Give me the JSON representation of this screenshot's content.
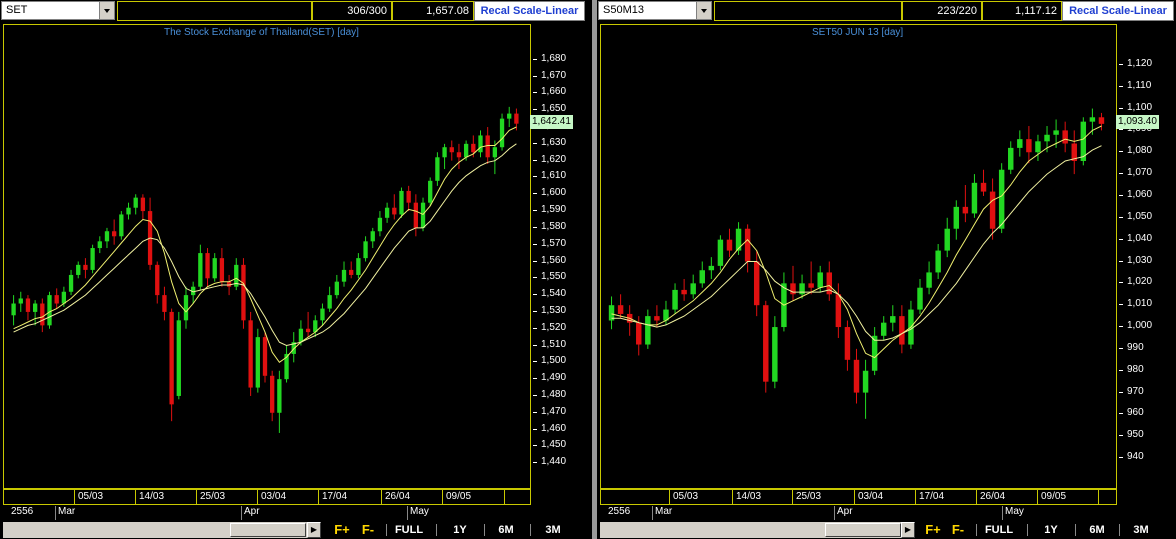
{
  "colors": {
    "up": "#22d822",
    "down": "#e01010",
    "ma_fast": "#f0f070",
    "ma_slow": "#f0f0a0",
    "frame": "#c8c800",
    "title": "#4a90d9"
  },
  "buttons": {
    "f_plus": "F+",
    "f_minus": "F-",
    "full": "FULL",
    "y1": "1Y",
    "m6": "6M",
    "m3": "3M"
  },
  "panels": [
    {
      "symbol": "SET",
      "count": "306/300",
      "price": "1,657.08",
      "recal": "Recal Scale-Linear",
      "title": "The Stock Exchange of Thailand(SET)",
      "period": "[day]",
      "last": "1,642.41",
      "dates": [
        "05/03",
        "14/03",
        "25/03",
        "03/04",
        "17/04",
        "26/04",
        "09/05"
      ],
      "year": "2556",
      "months": [
        "Mar",
        "Apr",
        "May"
      ]
    },
    {
      "symbol": "S50M13",
      "count": "223/220",
      "price": "1,117.12",
      "recal": "Recal Scale-Linear",
      "title": "SET50 JUN 13",
      "period": "[day]",
      "last": "1,093.40",
      "dates": [
        "05/03",
        "14/03",
        "25/03",
        "03/04",
        "17/04",
        "26/04",
        "09/05"
      ],
      "year": "2556",
      "months": [
        "Mar",
        "Apr",
        "May"
      ]
    }
  ],
  "chart_data": [
    {
      "type": "candlestick",
      "title": "The Stock Exchange of Thailand(SET) [day]",
      "ylim": [
        1430,
        1690
      ],
      "yticks": [
        1440,
        1450,
        1460,
        1470,
        1480,
        1490,
        1500,
        1510,
        1520,
        1530,
        1540,
        1550,
        1560,
        1570,
        1580,
        1590,
        1600,
        1610,
        1620,
        1630,
        1640,
        1650,
        1660,
        1670,
        1680
      ],
      "ytick_labels": [
        "1,440",
        "1,450",
        "1,460",
        "1,470",
        "1,480",
        "1,490",
        "1,500",
        "1,510",
        "1,520",
        "1,530",
        "1,540",
        "1,550",
        "1,560",
        "1,570",
        "1,580",
        "1,590",
        "1,600",
        "1,610",
        "1,620",
        "1,630",
        "1,640",
        "1,650",
        "1,660",
        "1,670",
        "1,680"
      ],
      "last_value": 1642.41,
      "candles": [
        [
          1528,
          1540,
          1522,
          1535
        ],
        [
          1535,
          1542,
          1530,
          1538
        ],
        [
          1538,
          1540,
          1525,
          1530
        ],
        [
          1530,
          1537,
          1522,
          1535
        ],
        [
          1535,
          1538,
          1518,
          1522
        ],
        [
          1522,
          1542,
          1520,
          1540
        ],
        [
          1540,
          1544,
          1532,
          1535
        ],
        [
          1535,
          1545,
          1533,
          1542
        ],
        [
          1542,
          1555,
          1540,
          1552
        ],
        [
          1552,
          1560,
          1550,
          1558
        ],
        [
          1558,
          1562,
          1550,
          1555
        ],
        [
          1555,
          1570,
          1553,
          1568
        ],
        [
          1568,
          1575,
          1565,
          1572
        ],
        [
          1572,
          1580,
          1568,
          1578
        ],
        [
          1578,
          1585,
          1570,
          1575
        ],
        [
          1575,
          1590,
          1573,
          1588
        ],
        [
          1588,
          1595,
          1585,
          1592
        ],
        [
          1592,
          1600,
          1588,
          1598
        ],
        [
          1598,
          1600,
          1585,
          1590
        ],
        [
          1590,
          1598,
          1555,
          1558
        ],
        [
          1558,
          1560,
          1535,
          1540
        ],
        [
          1540,
          1545,
          1525,
          1530
        ],
        [
          1530,
          1532,
          1465,
          1475
        ],
        [
          1480,
          1530,
          1478,
          1525
        ],
        [
          1525,
          1545,
          1520,
          1540
        ],
        [
          1540,
          1548,
          1535,
          1545
        ],
        [
          1545,
          1570,
          1543,
          1565
        ],
        [
          1565,
          1568,
          1545,
          1550
        ],
        [
          1550,
          1565,
          1548,
          1562
        ],
        [
          1562,
          1568,
          1545,
          1548
        ],
        [
          1548,
          1552,
          1540,
          1545
        ],
        [
          1545,
          1562,
          1543,
          1558
        ],
        [
          1558,
          1562,
          1520,
          1525
        ],
        [
          1525,
          1530,
          1480,
          1485
        ],
        [
          1485,
          1520,
          1482,
          1515
        ],
        [
          1515,
          1518,
          1488,
          1492
        ],
        [
          1492,
          1495,
          1465,
          1470
        ],
        [
          1470,
          1495,
          1458,
          1490
        ],
        [
          1490,
          1510,
          1488,
          1505
        ],
        [
          1505,
          1518,
          1500,
          1512
        ],
        [
          1512,
          1525,
          1510,
          1520
        ],
        [
          1520,
          1530,
          1515,
          1518
        ],
        [
          1518,
          1528,
          1515,
          1525
        ],
        [
          1525,
          1535,
          1522,
          1532
        ],
        [
          1532,
          1545,
          1530,
          1540
        ],
        [
          1540,
          1552,
          1538,
          1548
        ],
        [
          1548,
          1560,
          1545,
          1555
        ],
        [
          1555,
          1560,
          1550,
          1552
        ],
        [
          1552,
          1565,
          1550,
          1562
        ],
        [
          1562,
          1575,
          1560,
          1572
        ],
        [
          1572,
          1580,
          1568,
          1578
        ],
        [
          1578,
          1590,
          1575,
          1586
        ],
        [
          1586,
          1595,
          1583,
          1592
        ],
        [
          1592,
          1600,
          1585,
          1588
        ],
        [
          1588,
          1604,
          1586,
          1602
        ],
        [
          1602,
          1605,
          1590,
          1595
        ],
        [
          1595,
          1600,
          1575,
          1580
        ],
        [
          1580,
          1598,
          1578,
          1595
        ],
        [
          1595,
          1610,
          1593,
          1608
        ],
        [
          1608,
          1625,
          1605,
          1622
        ],
        [
          1622,
          1630,
          1615,
          1628
        ],
        [
          1628,
          1632,
          1620,
          1625
        ],
        [
          1625,
          1630,
          1615,
          1622
        ],
        [
          1622,
          1632,
          1620,
          1630
        ],
        [
          1630,
          1635,
          1622,
          1625
        ],
        [
          1625,
          1638,
          1622,
          1635
        ],
        [
          1635,
          1640,
          1618,
          1622
        ],
        [
          1622,
          1632,
          1612,
          1628
        ],
        [
          1628,
          1648,
          1626,
          1645
        ],
        [
          1645,
          1652,
          1640,
          1648
        ],
        [
          1648,
          1651,
          1638,
          1642
        ]
      ],
      "ma_fast": [
        1520,
        1522,
        1524,
        1526,
        1527,
        1530,
        1532,
        1535,
        1538,
        1542,
        1546,
        1551,
        1556,
        1561,
        1566,
        1571,
        1576,
        1581,
        1585,
        1584,
        1578,
        1565,
        1548,
        1535,
        1530,
        1535,
        1541,
        1545,
        1547,
        1548,
        1548,
        1550,
        1547,
        1538,
        1528,
        1518,
        1506,
        1500,
        1503,
        1508,
        1512,
        1515,
        1518,
        1522,
        1527,
        1532,
        1538,
        1543,
        1549,
        1555,
        1562,
        1569,
        1576,
        1582,
        1587,
        1591,
        1590,
        1588,
        1593,
        1601,
        1609,
        1615,
        1619,
        1622,
        1624,
        1628,
        1629,
        1629,
        1633,
        1638,
        1640
      ],
      "ma_slow": [
        1518,
        1520,
        1522,
        1523,
        1525,
        1527,
        1529,
        1531,
        1534,
        1537,
        1540,
        1544,
        1548,
        1552,
        1556,
        1560,
        1564,
        1568,
        1572,
        1574,
        1573,
        1568,
        1560,
        1551,
        1544,
        1542,
        1543,
        1544,
        1545,
        1546,
        1546,
        1547,
        1546,
        1541,
        1534,
        1527,
        1519,
        1512,
        1510,
        1511,
        1512,
        1514,
        1516,
        1518,
        1521,
        1525,
        1529,
        1534,
        1539,
        1544,
        1550,
        1556,
        1562,
        1568,
        1573,
        1578,
        1580,
        1580,
        1584,
        1590,
        1596,
        1602,
        1607,
        1611,
        1614,
        1617,
        1619,
        1620,
        1623,
        1627,
        1630
      ]
    },
    {
      "type": "candlestick",
      "title": "SET50 JUN 13 [day]",
      "ylim": [
        930,
        1130
      ],
      "yticks": [
        940,
        950,
        960,
        970,
        980,
        990,
        1000,
        1010,
        1020,
        1030,
        1040,
        1050,
        1060,
        1070,
        1080,
        1090,
        1100,
        1110,
        1120
      ],
      "ytick_labels": [
        "940",
        "950",
        "960",
        "970",
        "980",
        "990",
        "1,000",
        "1,010",
        "1,020",
        "1,030",
        "1,040",
        "1,050",
        "1,060",
        "1,070",
        "1,080",
        "1,090",
        "1,100",
        "1,110",
        "1,120"
      ],
      "last_value": 1093.4,
      "candles": [
        [
          1003,
          1014,
          999,
          1010
        ],
        [
          1010,
          1015,
          1004,
          1006
        ],
        [
          1006,
          1010,
          996,
          1002
        ],
        [
          1002,
          1005,
          987,
          992
        ],
        [
          992,
          1008,
          990,
          1005
        ],
        [
          1005,
          1010,
          1000,
          1003
        ],
        [
          1003,
          1012,
          1001,
          1008
        ],
        [
          1008,
          1020,
          1006,
          1017
        ],
        [
          1017,
          1022,
          1012,
          1015
        ],
        [
          1015,
          1024,
          1013,
          1020
        ],
        [
          1020,
          1030,
          1018,
          1026
        ],
        [
          1026,
          1032,
          1022,
          1028
        ],
        [
          1028,
          1042,
          1026,
          1040
        ],
        [
          1040,
          1045,
          1032,
          1035
        ],
        [
          1035,
          1048,
          1033,
          1045
        ],
        [
          1045,
          1047,
          1025,
          1030
        ],
        [
          1030,
          1035,
          1005,
          1010
        ],
        [
          1010,
          1012,
          970,
          975
        ],
        [
          975,
          1005,
          972,
          1000
        ],
        [
          1000,
          1025,
          998,
          1020
        ],
        [
          1020,
          1028,
          1012,
          1015
        ],
        [
          1015,
          1024,
          1013,
          1020
        ],
        [
          1020,
          1030,
          1015,
          1018
        ],
        [
          1018,
          1028,
          1016,
          1025
        ],
        [
          1025,
          1030,
          1012,
          1015
        ],
        [
          1015,
          1020,
          995,
          1000
        ],
        [
          1000,
          1003,
          980,
          985
        ],
        [
          985,
          990,
          965,
          970
        ],
        [
          970,
          985,
          958,
          980
        ],
        [
          980,
          1000,
          978,
          996
        ],
        [
          996,
          1005,
          994,
          1002
        ],
        [
          1002,
          1010,
          998,
          1005
        ],
        [
          1005,
          1010,
          988,
          992
        ],
        [
          992,
          1012,
          990,
          1008
        ],
        [
          1008,
          1022,
          1006,
          1018
        ],
        [
          1018,
          1030,
          1015,
          1025
        ],
        [
          1025,
          1038,
          1022,
          1035
        ],
        [
          1035,
          1050,
          1032,
          1045
        ],
        [
          1045,
          1058,
          1040,
          1055
        ],
        [
          1055,
          1065,
          1048,
          1052
        ],
        [
          1052,
          1070,
          1050,
          1066
        ],
        [
          1066,
          1072,
          1060,
          1062
        ],
        [
          1062,
          1068,
          1040,
          1045
        ],
        [
          1045,
          1075,
          1043,
          1072
        ],
        [
          1072,
          1085,
          1070,
          1082
        ],
        [
          1082,
          1090,
          1078,
          1086
        ],
        [
          1086,
          1092,
          1075,
          1080
        ],
        [
          1080,
          1088,
          1076,
          1085
        ],
        [
          1085,
          1092,
          1080,
          1088
        ],
        [
          1088,
          1095,
          1082,
          1090
        ],
        [
          1090,
          1094,
          1080,
          1084
        ],
        [
          1084,
          1090,
          1070,
          1076
        ],
        [
          1076,
          1096,
          1074,
          1094
        ],
        [
          1094,
          1100,
          1088,
          1096
        ],
        [
          1096,
          1098,
          1090,
          1093
        ]
      ],
      "ma_fast": [
        1006,
        1005,
        1004,
        1002,
        1001,
        1001,
        1003,
        1006,
        1009,
        1012,
        1016,
        1020,
        1025,
        1031,
        1036,
        1040,
        1035,
        1025,
        1013,
        1010,
        1012,
        1014,
        1016,
        1018,
        1019,
        1015,
        1008,
        997,
        988,
        986,
        990,
        994,
        997,
        1000,
        1005,
        1011,
        1018,
        1025,
        1033,
        1040,
        1047,
        1054,
        1058,
        1060,
        1065,
        1071,
        1076,
        1079,
        1082,
        1084,
        1086,
        1085,
        1086,
        1090,
        1092
      ],
      "ma_slow": [
        1004,
        1004,
        1003,
        1002,
        1001,
        1000,
        1001,
        1003,
        1005,
        1008,
        1011,
        1014,
        1018,
        1022,
        1026,
        1030,
        1030,
        1026,
        1021,
        1018,
        1016,
        1016,
        1016,
        1016,
        1017,
        1015,
        1011,
        1005,
        998,
        994,
        994,
        995,
        997,
        999,
        1002,
        1006,
        1010,
        1015,
        1020,
        1026,
        1032,
        1038,
        1043,
        1047,
        1052,
        1057,
        1062,
        1066,
        1070,
        1073,
        1076,
        1077,
        1078,
        1081,
        1083
      ]
    }
  ]
}
